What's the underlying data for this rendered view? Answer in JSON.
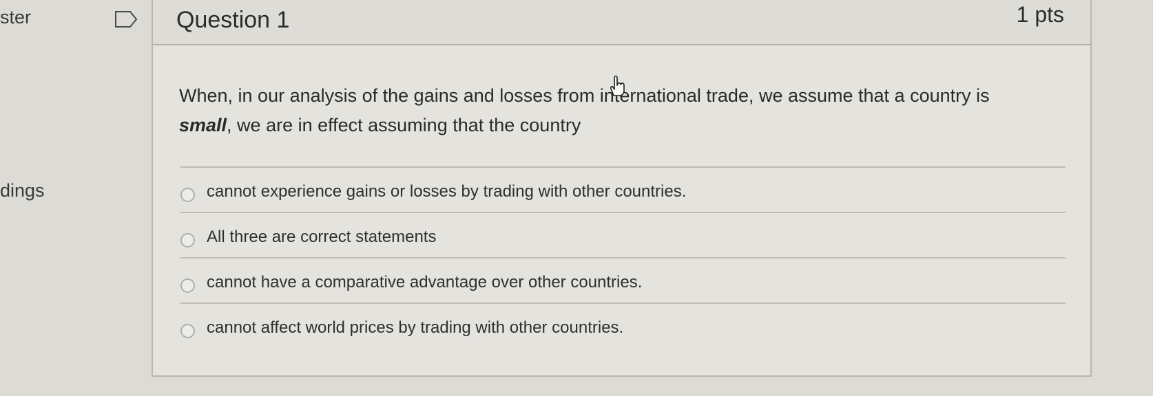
{
  "left_nav": {
    "fragments": [
      "ster",
      "dings"
    ]
  },
  "question": {
    "title": "Question 1",
    "points": "1 pts",
    "text_prefix": "When, in our analysis of the gains and losses from international trade, we assume that a country is ",
    "text_emphasis": "small",
    "text_suffix": ", we are in effect assuming that the country",
    "answers": [
      {
        "label": "cannot experience gains or losses by trading with other countries."
      },
      {
        "label": "All three are correct statements"
      },
      {
        "label": "cannot have a comparative advantage over other countries."
      },
      {
        "label": "cannot affect world prices by trading with other countries."
      }
    ]
  },
  "icons": {
    "flag": "bookmark-flag-icon",
    "cursor": "hand-pointer-icon"
  }
}
